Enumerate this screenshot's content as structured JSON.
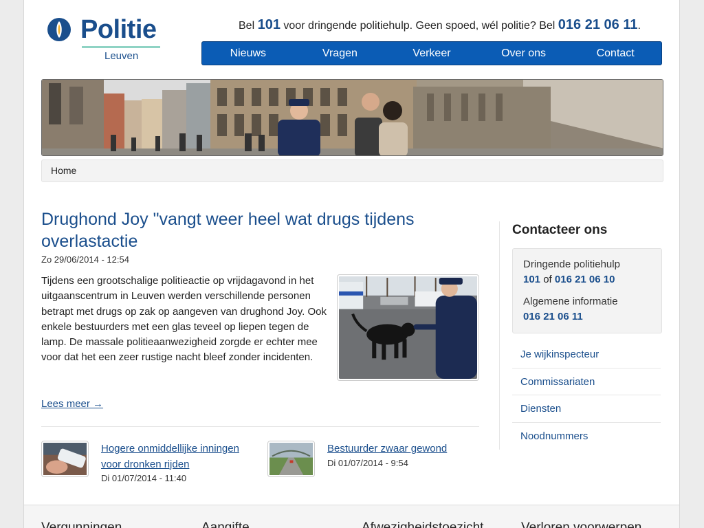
{
  "brand": {
    "name": "Politie",
    "city": "Leuven",
    "accent": "#1a4e8c",
    "nav_color": "#0b5cb5"
  },
  "hotline": {
    "prefix": "Bel ",
    "emergency_number": "101",
    "middle": " voor dringende politiehulp. Geen spoed, wél politie? Bel ",
    "info_number": "016 21 06 11",
    "suffix": "."
  },
  "nav": [
    "Nieuws",
    "Vragen",
    "Verkeer",
    "Over ons",
    "Contact"
  ],
  "breadcrumb": "Home",
  "article": {
    "title": "Drughond Joy \"vangt weer heel wat drugs tijdens overlastactie",
    "date": "Zo 29/06/2014 - 12:54",
    "body": "Tijdens een grootschalige politieactie op vrijdagavond in het uitgaanscentrum in Leuven werden verschillende personen betrapt met drugs op zak op aangeven van drughond Joy. Ook enkele bestuurders met een glas teveel op liepen tegen de lamp. De massale politieaanwezigheid zorgde er echter mee voor dat het een zeer rustige nacht bleef zonder incidenten.",
    "read_more": "Lees meer →"
  },
  "teasers": [
    {
      "title": "Hogere onmiddellijke inningen voor dronken rijden",
      "date": "Di 01/07/2014 - 11:40"
    },
    {
      "title": "Bestuurder zwaar gewond",
      "date": "Di 01/07/2014 - 9:54"
    }
  ],
  "sidebar": {
    "title": "Contacteer ons",
    "urgent_label": "Dringende politiehulp",
    "urgent_number": "101",
    "urgent_or": " of ",
    "urgent_number_alt": "016 21 06 10",
    "general_label": "Algemene informatie",
    "general_number": "016 21 06 11",
    "links": [
      "Je wijkinspecteur",
      "Commissariaten",
      "Diensten",
      "Noodnummers"
    ]
  },
  "footer": [
    "Vergunningen",
    "Aangifte",
    "Afwezigheidstoezicht",
    "Verloren voorwerpen"
  ]
}
